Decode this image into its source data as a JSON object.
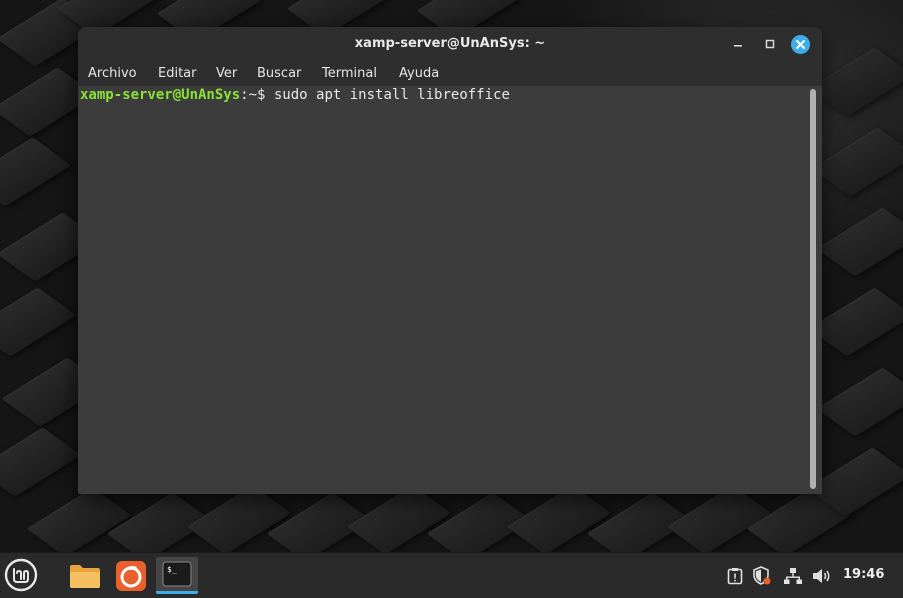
{
  "window": {
    "title": "xamp-server@UnAnSys: ~",
    "controls": {
      "minimize_icon": "minimize-icon",
      "maximize_icon": "maximize-icon",
      "close_icon": "close-icon"
    }
  },
  "menu": {
    "items": [
      "Archivo",
      "Editar",
      "Ver",
      "Buscar",
      "Terminal",
      "Ayuda"
    ]
  },
  "terminal": {
    "prompt_user": "xamp-server@UnAnSys",
    "prompt_path": ":~$",
    "command": " sudo apt install libreoffice"
  },
  "taskbar": {
    "launcher_icon": "linux-mint-menu-icon",
    "apps": [
      "files-folder-icon",
      "firefox-icon",
      "terminal-icon"
    ],
    "terminal_app_glyph": "$_",
    "tray": [
      "clipboard-icon",
      "shield-icon",
      "network-icon",
      "volume-icon"
    ],
    "clock": "19:46"
  },
  "colors": {
    "accent": "#3daee9",
    "prompt_green": "#8ae234",
    "terminal_bg": "#3c3c3c",
    "titlebar_bg": "#2e2e2e",
    "taskbar_bg": "#2a2a2a"
  }
}
